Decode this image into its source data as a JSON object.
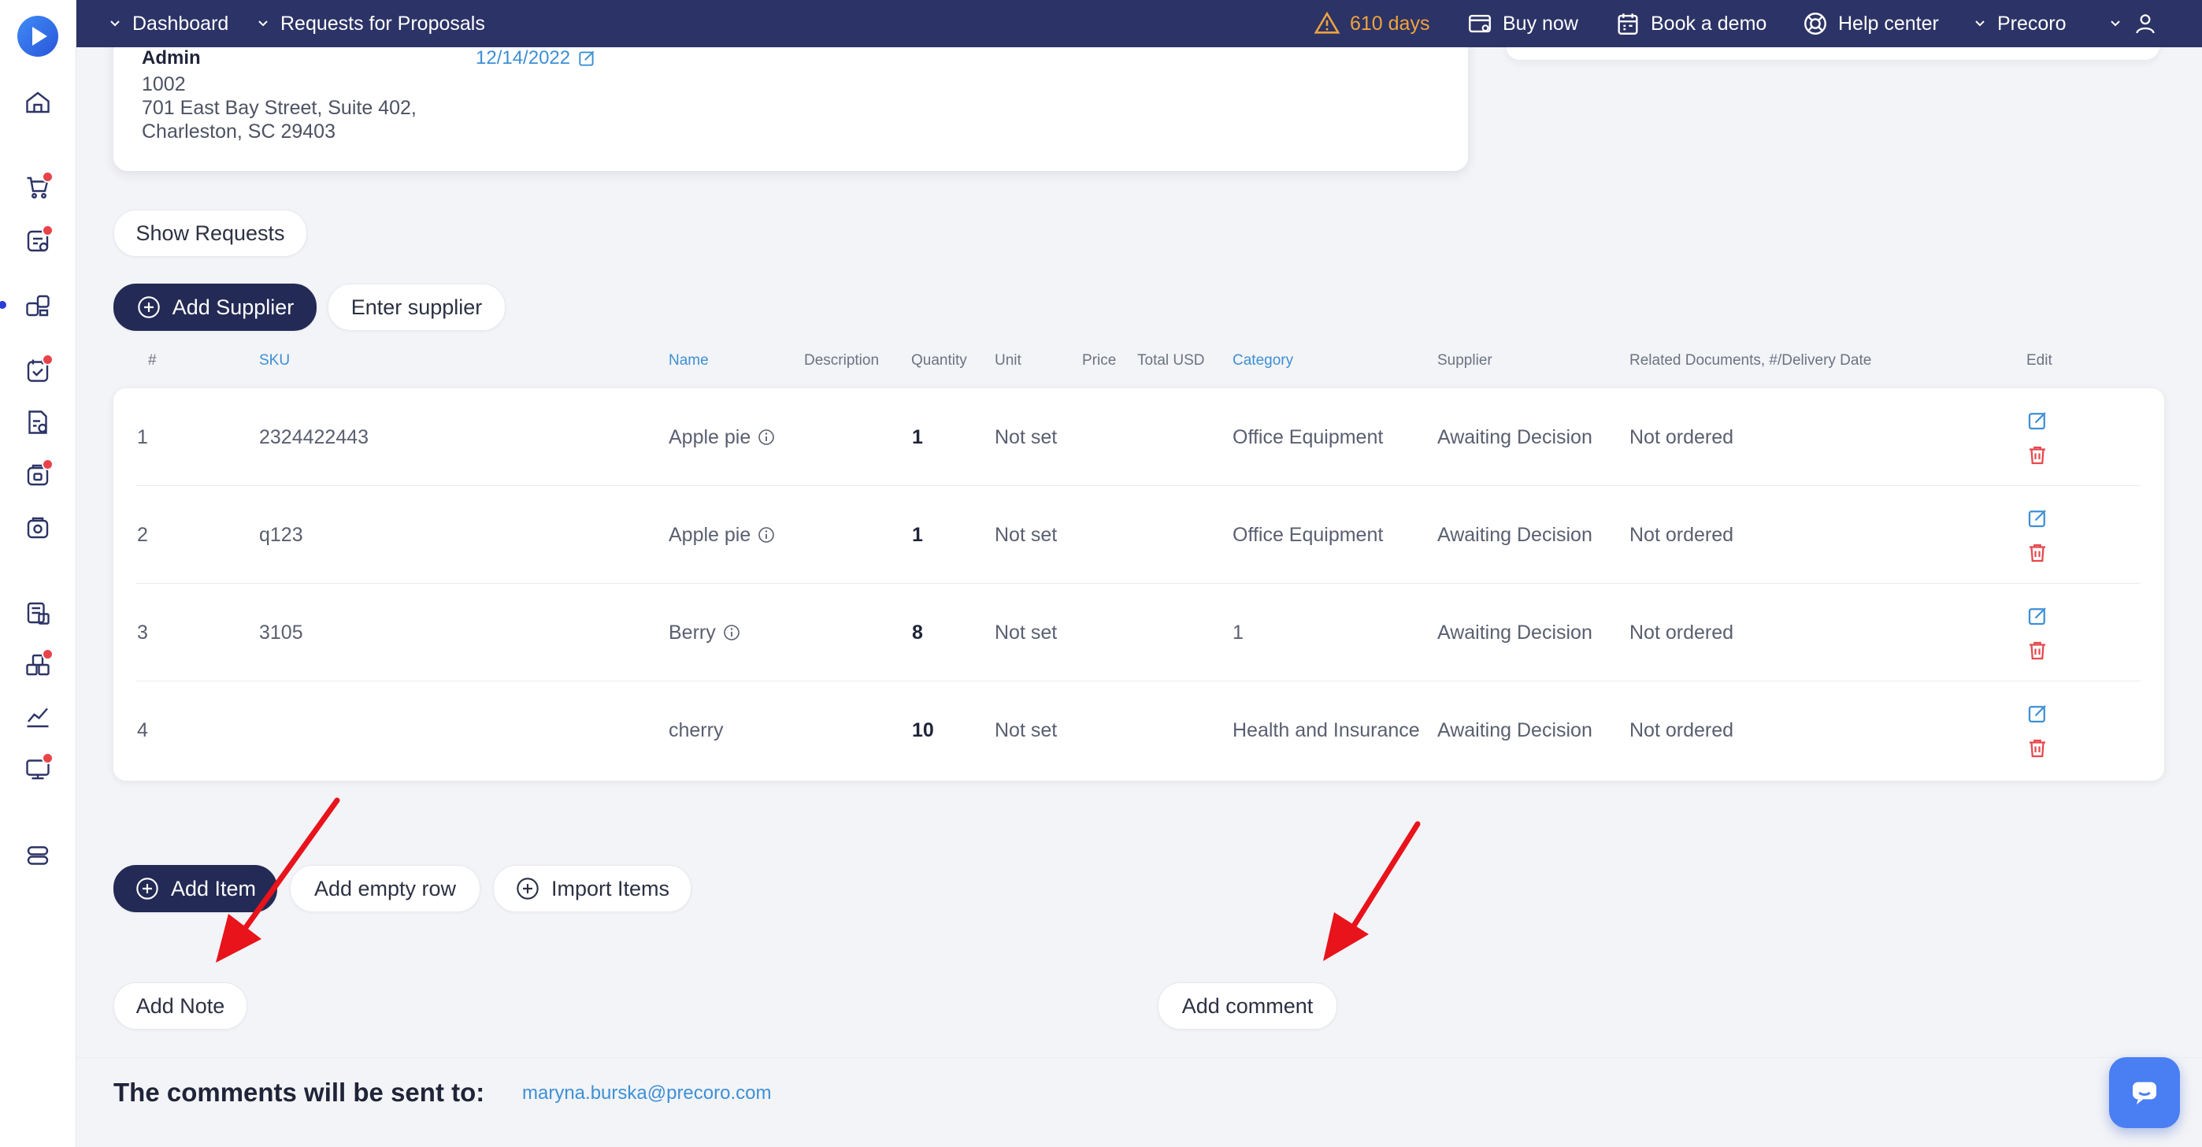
{
  "topbar": {
    "breadcrumb_1": "Dashboard",
    "breadcrumb_2": "Requests for Proposals",
    "trial": "610 days",
    "buy_now": "Buy now",
    "book_demo": "Book a demo",
    "help_center": "Help center",
    "company": "Precoro"
  },
  "info_card": {
    "role": "Admin",
    "address_lines": "1002\n701 East Bay Street, Suite 402,\nCharleston, SC 29403",
    "date": "12/14/2022"
  },
  "buttons": {
    "show_requests": "Show Requests",
    "add_supplier": "Add Supplier",
    "enter_supplier": "Enter supplier",
    "add_item": "Add Item",
    "add_empty_row": "Add empty row",
    "import_items": "Import Items",
    "add_note": "Add Note",
    "add_comment": "Add comment"
  },
  "table": {
    "headers": {
      "num": "#",
      "sku": "SKU",
      "name": "Name",
      "description": "Description",
      "quantity": "Quantity",
      "unit": "Unit",
      "price": "Price",
      "total": "Total USD",
      "category": "Category",
      "supplier": "Supplier",
      "related": "Related Documents, #/Delivery Date",
      "edit": "Edit"
    },
    "rows": [
      {
        "num": "1",
        "sku": "2324422443",
        "name": "Apple pie",
        "quantity": "1",
        "unit": "Not set",
        "category": "Office Equipment",
        "supplier": "Awaiting Decision",
        "related": "Not ordered"
      },
      {
        "num": "2",
        "sku": "q123",
        "name": "Apple pie",
        "quantity": "1",
        "unit": "Not set",
        "category": "Office Equipment",
        "supplier": "Awaiting Decision",
        "related": "Not ordered"
      },
      {
        "num": "3",
        "sku": "3105",
        "name": "Berry",
        "quantity": "8",
        "unit": "Not set",
        "category": "1",
        "supplier": "Awaiting Decision",
        "related": "Not ordered"
      },
      {
        "num": "4",
        "sku": "",
        "name": "cherry",
        "quantity": "10",
        "unit": "Not set",
        "category": "Health and Insurance",
        "supplier": "Awaiting Decision",
        "related": "Not ordered"
      }
    ]
  },
  "comments": {
    "label": "The comments will be sent to:",
    "email": "maryna.burska@precoro.com"
  },
  "colors": {
    "topbar": "#2c3366",
    "primary_button": "#232a55",
    "link": "#3d8fd6",
    "delete": "#e5484d",
    "warning": "#f0a33d",
    "annotation_arrow": "#e8131b"
  }
}
